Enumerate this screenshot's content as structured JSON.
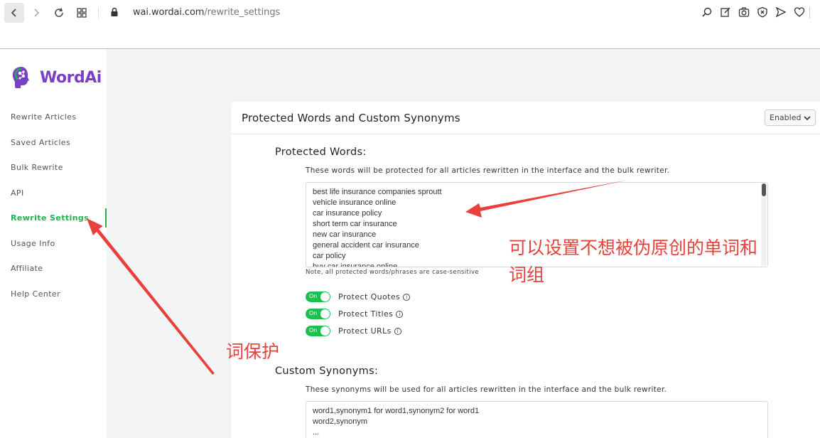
{
  "browser": {
    "url_host": "wai.wordai.com",
    "url_path": "/rewrite_settings"
  },
  "sidebar": {
    "logo_text": "WordAi",
    "items": [
      {
        "label": "Rewrite Articles"
      },
      {
        "label": "Saved Articles"
      },
      {
        "label": "Bulk Rewrite"
      },
      {
        "label": "API"
      },
      {
        "label": "Rewrite Settings",
        "active": true
      },
      {
        "label": "Usage Info"
      },
      {
        "label": "Affiliate"
      },
      {
        "label": "Help Center"
      }
    ]
  },
  "card": {
    "title": "Protected Words and Custom Synonyms",
    "status_select": "Enabled"
  },
  "protected": {
    "title": "Protected Words:",
    "description": "These words will be protected for all articles rewritten in the interface and the bulk rewriter.",
    "lines": [
      "best life insurance companies sproutt",
      "vehicle insurance online",
      "car insurance policy",
      "short term car insurance",
      "new car insurance",
      "general accident car insurance",
      "car policy",
      "buy car insurance online"
    ],
    "note": "Note, all protected words/phrases are case-sensitive"
  },
  "toggles": [
    {
      "state": "On",
      "label": "Protect Quotes"
    },
    {
      "state": "On",
      "label": "Protect Titles"
    },
    {
      "state": "On",
      "label": "Protect URLs"
    }
  ],
  "custom": {
    "title": "Custom Synonyms:",
    "description": "These synonyms will be used for all articles rewritten in the interface and the bulk rewriter.",
    "lines": [
      "word1,synonym1 for word1,synonym2 for word1",
      "word2,synonym",
      "..."
    ]
  },
  "annotations": {
    "right_line1": "可以设置不想被伪原创的单词和",
    "right_line2": "词组",
    "left": "词保护"
  },
  "colors": {
    "brand_purple": "#7b3fc6",
    "active_green": "#22b14c",
    "toggle_green": "#1fbf4f",
    "annotation_red": "#e8403a"
  }
}
